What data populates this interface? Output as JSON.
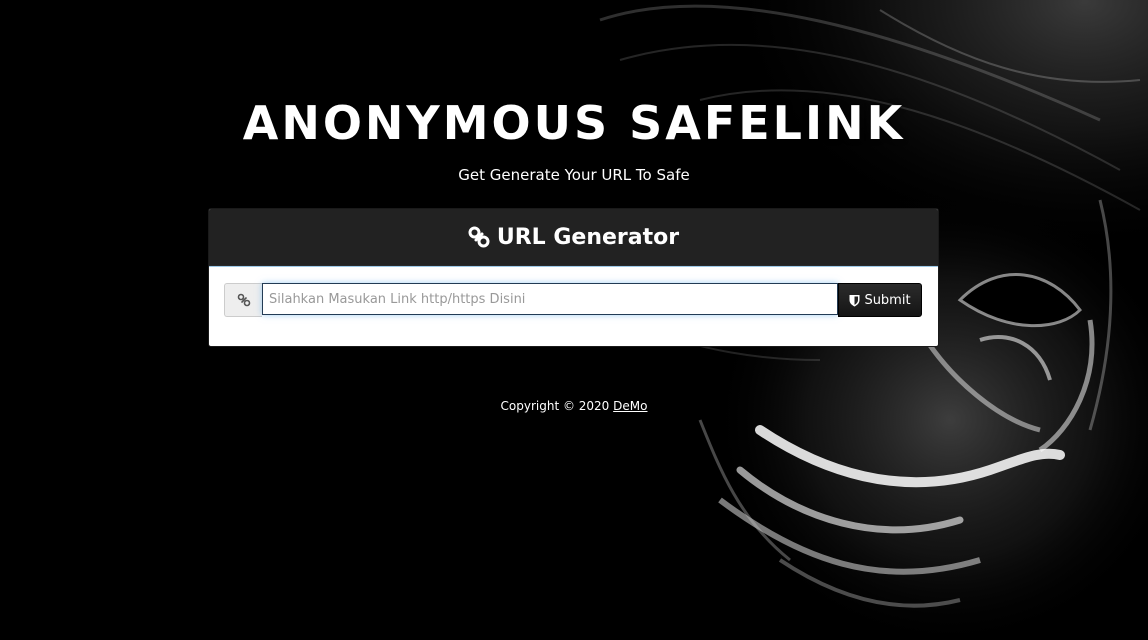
{
  "header": {
    "title": "ANONYMOUS SAFELINK",
    "subtitle": "Get Generate Your URL To Safe"
  },
  "panel": {
    "heading": "URL Generator",
    "heading_icon": "link-icon"
  },
  "form": {
    "addon_icon": "link-icon",
    "input_value": "",
    "input_placeholder": "Silahkan Masukan Link http/https Disini",
    "submit_icon": "shield-icon",
    "submit_label": "Submit"
  },
  "footer": {
    "copyright_text": "Copyright © 2020",
    "link_text": "DeMo"
  },
  "colors": {
    "background": "#000000",
    "panel_heading": "#222222",
    "button": "#1f1f1f"
  }
}
